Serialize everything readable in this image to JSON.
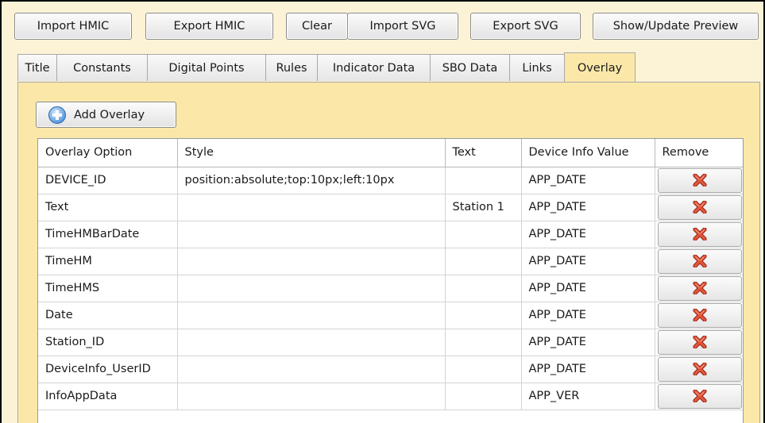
{
  "toolbar": {
    "import_hmic": "Import HMIC",
    "export_hmic": "Export HMIC",
    "clear": "Clear",
    "import_svg": "Import SVG",
    "export_svg": "Export SVG",
    "show_update_preview": "Show/Update Preview"
  },
  "tabs": [
    {
      "label": "Title"
    },
    {
      "label": "Constants"
    },
    {
      "label": "Digital Points"
    },
    {
      "label": "Rules"
    },
    {
      "label": "Indicator Data"
    },
    {
      "label": "SBO Data"
    },
    {
      "label": "Links"
    },
    {
      "label": "Overlay",
      "active": true
    }
  ],
  "overlay": {
    "add_button_label": "Add Overlay",
    "columns": [
      "Overlay Option",
      "Style",
      "Text",
      "Device Info Value",
      "Remove"
    ],
    "rows": [
      {
        "option": "DEVICE_ID",
        "style": "position:absolute;top:10px;left:10px",
        "text": "",
        "device_info": "APP_DATE"
      },
      {
        "option": "Text",
        "style": "",
        "text": "Station 1",
        "device_info": "APP_DATE"
      },
      {
        "option": "TimeHMBarDate",
        "style": "",
        "text": "",
        "device_info": "APP_DATE"
      },
      {
        "option": "TimeHM",
        "style": "",
        "text": "",
        "device_info": "APP_DATE"
      },
      {
        "option": "TimeHMS",
        "style": "",
        "text": "",
        "device_info": "APP_DATE"
      },
      {
        "option": "Date",
        "style": "",
        "text": "",
        "device_info": "APP_DATE"
      },
      {
        "option": "Station_ID",
        "style": "",
        "text": "",
        "device_info": "APP_DATE"
      },
      {
        "option": "DeviceInfo_UserID",
        "style": "",
        "text": "",
        "device_info": "APP_DATE"
      },
      {
        "option": "InfoAppData",
        "style": "",
        "text": "",
        "device_info": "APP_VER"
      }
    ],
    "remove_icon": "red-x-icon"
  },
  "colors": {
    "window_background": "#fcf3d7",
    "panel_background": "#fbe8a9",
    "remove_icon": "#d9472b"
  }
}
